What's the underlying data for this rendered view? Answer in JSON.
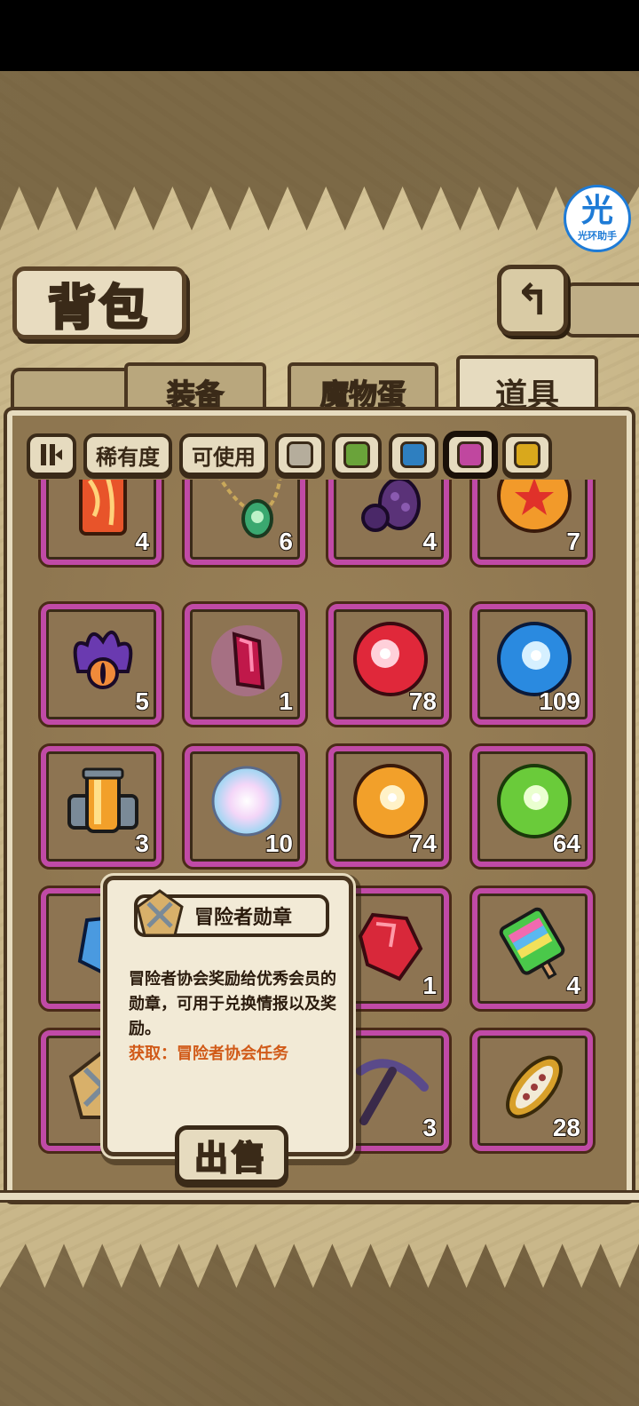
{
  "title": "背包",
  "watermark": {
    "glyph": "光",
    "text": "光环助手"
  },
  "return_icon": "return-icon",
  "tabs": [
    {
      "label": "装备",
      "active": false
    },
    {
      "label": "魔物蛋",
      "active": false
    },
    {
      "label": "道具",
      "active": true
    }
  ],
  "filters": {
    "sort_icon": "sort-toggle-icon",
    "rarity": "稀有度",
    "usable": "可使用",
    "colors": [
      {
        "name": "gray",
        "hex": "#b5ad9c"
      },
      {
        "name": "green",
        "hex": "#6aa33a"
      },
      {
        "name": "blue",
        "hex": "#2e7fc0"
      },
      {
        "name": "purple",
        "hex": "#c0479f",
        "selected": true
      },
      {
        "name": "gold",
        "hex": "#d9a81c"
      }
    ]
  },
  "items": [
    {
      "icon": "amber-block-icon",
      "count": "4"
    },
    {
      "icon": "gem-necklace-icon",
      "count": "6"
    },
    {
      "icon": "purple-egg-icon",
      "count": "4"
    },
    {
      "icon": "star-orb-icon",
      "count": "7"
    },
    {
      "icon": "tentacle-eye-icon",
      "count": "5"
    },
    {
      "icon": "crimson-crystal-icon",
      "count": "1"
    },
    {
      "icon": "red-orb-icon",
      "count": "78"
    },
    {
      "icon": "blue-orb-icon",
      "count": "109"
    },
    {
      "icon": "energy-canister-icon",
      "count": "3"
    },
    {
      "icon": "rainbow-fluff-icon",
      "count": "10"
    },
    {
      "icon": "orange-orb-icon",
      "count": "74"
    },
    {
      "icon": "green-orb-icon",
      "count": "64"
    },
    {
      "icon": "blue-crystal-icon",
      "count": ""
    },
    {
      "icon": "hidden-item-icon",
      "count": ""
    },
    {
      "icon": "red-gem-icon",
      "count": "1"
    },
    {
      "icon": "rainbow-popsicle-icon",
      "count": "4"
    },
    {
      "icon": "adventurer-medal-icon",
      "count": ""
    },
    {
      "icon": "hidden-item-icon",
      "count": ""
    },
    {
      "icon": "pickaxe-icon",
      "count": "3"
    },
    {
      "icon": "seed-pod-icon",
      "count": "28"
    }
  ],
  "tooltip": {
    "name": "冒险者勋章",
    "description": "冒险者协会奖励给优秀会员的勋章，可用于兑换情报以及奖励。",
    "source": "获取：冒险者协会任务",
    "sell_label": "出售"
  }
}
